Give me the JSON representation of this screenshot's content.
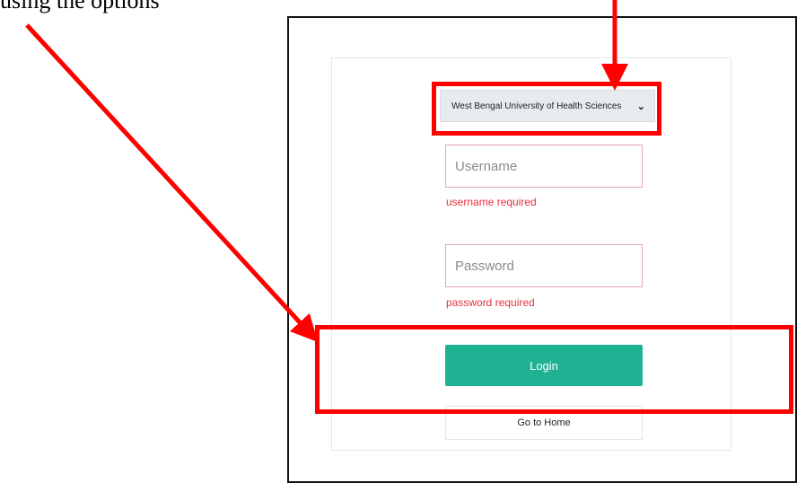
{
  "caption": "using the options",
  "university_select": {
    "selected": "West Bengal University of Health Sciences"
  },
  "username": {
    "placeholder": "Username",
    "error": "username required"
  },
  "password": {
    "placeholder": "Password",
    "error": "password required"
  },
  "login_label": "Login",
  "home_label": "Go to Home",
  "colors": {
    "annotation": "#ff0000",
    "login_button": "#1fb292",
    "error_text": "#e8303d",
    "field_border": "#e9a7ad"
  }
}
